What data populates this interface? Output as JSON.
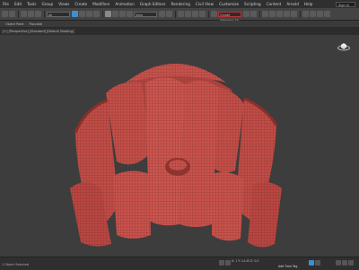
{
  "menu": {
    "items": [
      "File",
      "Edit",
      "Tools",
      "Group",
      "Views",
      "Create",
      "Modifiers",
      "Animation",
      "Graph Editors",
      "Rendering",
      "Civil View",
      "Customize",
      "Scripting",
      "Content",
      "Arnold",
      "Help"
    ],
    "signin": "Sign In"
  },
  "toolbar": {
    "dropdown1": "All",
    "dropdown2": "View",
    "dropdown3": "Create Selection Se"
  },
  "subbar": {
    "items": [
      "Object Paint",
      "Populate"
    ]
  },
  "viewport": {
    "label": "[+] [Perspective] [Standard] [Default Shading]",
    "mesh_color": "#c9534d",
    "wire_color": "#7a2a26"
  },
  "status": {
    "left_text": "1 Object Selected",
    "coords": "X: 1 Y: 14.45  Z: 0.0",
    "tag": "Add Time Tag"
  }
}
